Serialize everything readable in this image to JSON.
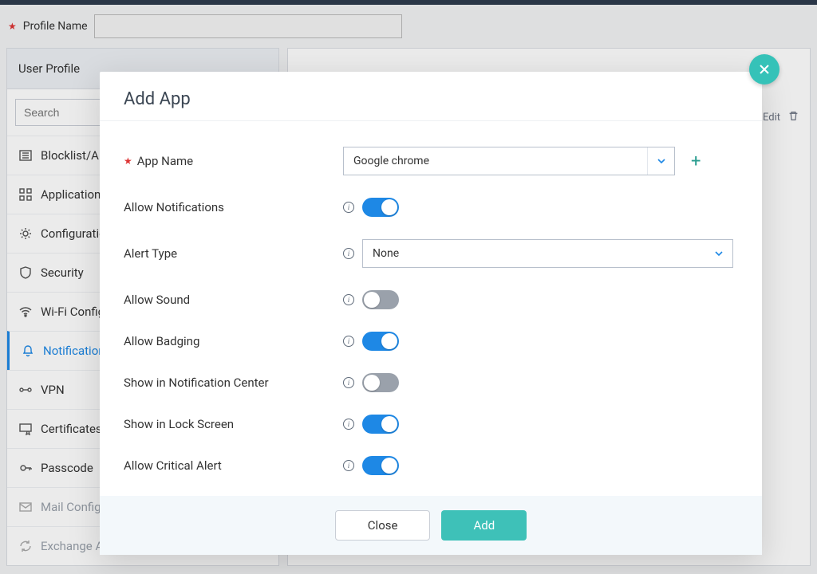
{
  "profile": {
    "label": "Profile Name",
    "value": ""
  },
  "sidebar": {
    "header": "User Profile",
    "search_placeholder": "Search",
    "items": [
      {
        "label": "Blocklist/Allowlist",
        "icon": "list-icon"
      },
      {
        "label": "Applications",
        "icon": "apps-icon"
      },
      {
        "label": "Configurations",
        "icon": "gear-icon"
      },
      {
        "label": "Security",
        "icon": "shield-icon"
      },
      {
        "label": "Wi-Fi Configuration",
        "icon": "wifi-icon"
      },
      {
        "label": "Notifications",
        "icon": "bell-icon"
      },
      {
        "label": "VPN",
        "icon": "vpn-icon"
      },
      {
        "label": "Certificates",
        "icon": "certificate-icon"
      },
      {
        "label": "Passcode",
        "icon": "key-icon"
      },
      {
        "label": "Mail Configuration",
        "icon": "mail-icon"
      },
      {
        "label": "Exchange ActiveSync",
        "icon": "sync-icon"
      }
    ]
  },
  "main_toolbar": {
    "edit": "Edit"
  },
  "modal": {
    "title": "Add App",
    "app_name_label": "App Name",
    "app_name_value": "Google chrome",
    "alert_type_label": "Alert Type",
    "alert_type_value": "None",
    "fields": {
      "allow_notifications": {
        "label": "Allow Notifications",
        "value": true
      },
      "allow_sound": {
        "label": "Allow Sound",
        "value": false
      },
      "allow_badging": {
        "label": "Allow Badging",
        "value": true
      },
      "show_in_nc": {
        "label": "Show in Notification Center",
        "value": false
      },
      "show_in_lock": {
        "label": "Show in Lock Screen",
        "value": true
      },
      "allow_critical": {
        "label": "Allow Critical Alert",
        "value": true
      }
    },
    "close_label": "Close",
    "add_label": "Add"
  }
}
